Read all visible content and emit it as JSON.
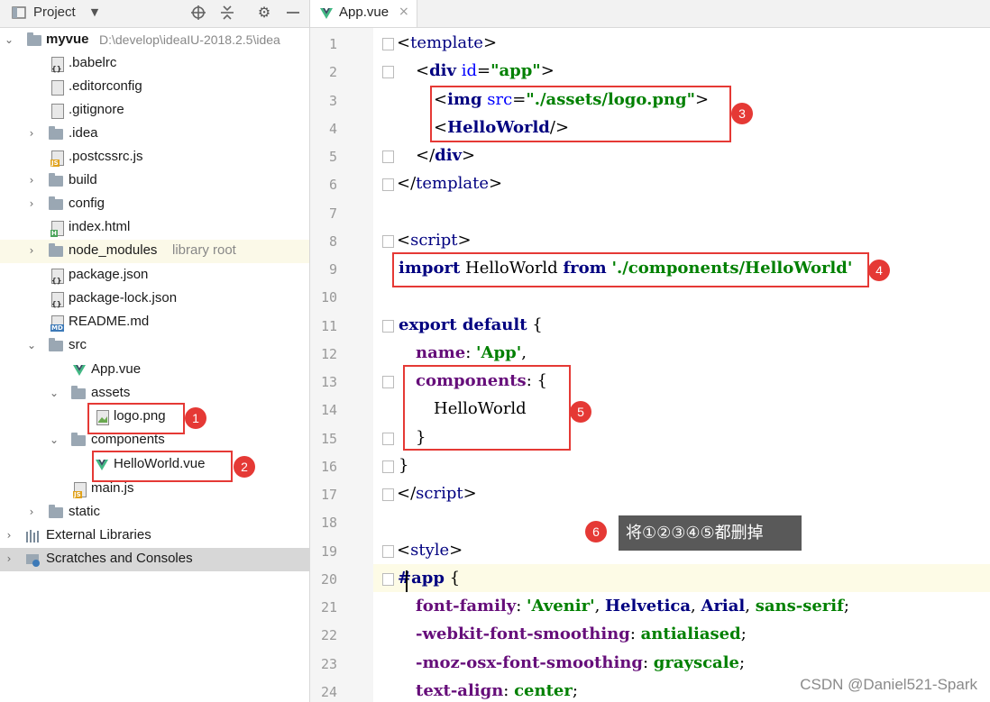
{
  "project_panel": {
    "title": "Project",
    "tree": [
      {
        "name": "myvue",
        "path": "D:\\develop\\ideaIU-2018.2.5\\idea",
        "icon": "folder-module-icon"
      },
      {
        "name": ".babelrc",
        "icon": "json-file-icon"
      },
      {
        "name": ".editorconfig",
        "icon": "text-file-icon"
      },
      {
        "name": ".gitignore",
        "icon": "text-file-icon"
      },
      {
        "name": ".idea",
        "icon": "folder-icon"
      },
      {
        "name": ".postcssrc.js",
        "icon": "js-file-icon"
      },
      {
        "name": "build",
        "icon": "folder-icon"
      },
      {
        "name": "config",
        "icon": "folder-icon"
      },
      {
        "name": "index.html",
        "icon": "html-file-icon"
      },
      {
        "name": "node_modules",
        "path": "library root",
        "icon": "folder-icon"
      },
      {
        "name": "package.json",
        "icon": "json-file-icon"
      },
      {
        "name": "package-lock.json",
        "icon": "json-file-icon"
      },
      {
        "name": "README.md",
        "icon": "markdown-file-icon"
      },
      {
        "name": "src",
        "icon": "folder-icon"
      },
      {
        "name": "App.vue",
        "icon": "vue-file-icon"
      },
      {
        "name": "assets",
        "icon": "folder-icon"
      },
      {
        "name": "logo.png",
        "icon": "image-file-icon"
      },
      {
        "name": "components",
        "icon": "folder-icon"
      },
      {
        "name": "HelloWorld.vue",
        "icon": "vue-file-icon"
      },
      {
        "name": "main.js",
        "icon": "js-file-icon"
      },
      {
        "name": "static",
        "icon": "folder-icon"
      },
      {
        "name": "External Libraries",
        "icon": "library-icon"
      },
      {
        "name": "Scratches and Consoles",
        "icon": "scratches-icon"
      }
    ]
  },
  "editor": {
    "tab_label": "App.vue",
    "line_numbers": [
      "1",
      "2",
      "3",
      "4",
      "5",
      "6",
      "7",
      "8",
      "9",
      "10",
      "11",
      "12",
      "13",
      "14",
      "15",
      "16",
      "17",
      "18",
      "19",
      "20",
      "21",
      "22",
      "23",
      "24"
    ],
    "code": {
      "l1": {
        "lt": "<",
        "tag": "template",
        "gt": ">"
      },
      "l2": {
        "lt": "<",
        "tag": "div",
        "attr": " id",
        "eq": "=",
        "val": "\"app\"",
        "gt": ">"
      },
      "l3": {
        "lt": "<",
        "tag": "img",
        "attr": " src",
        "eq": "=",
        "val": "\"./assets/logo.png\"",
        "gt": ">"
      },
      "l4": {
        "lt": "<",
        "tag": "HelloWorld",
        "end": "/>"
      },
      "l5": {
        "lt": "</",
        "tag": "div",
        "gt": ">"
      },
      "l6": {
        "lt": "</",
        "tag": "template",
        "gt": ">"
      },
      "l8": {
        "lt": "<",
        "tag": "script",
        "gt": ">"
      },
      "l9": {
        "kw1": "import",
        "id": " HelloWorld ",
        "kw2": "from",
        "sp": " ",
        "str": "'./components/HelloWorld'"
      },
      "l11": {
        "kw": "export default",
        "rest": " {"
      },
      "l12": {
        "prop": "name",
        "colon": ": ",
        "str": "'App'",
        "comma": ","
      },
      "l13": {
        "prop": "components",
        "rest": ": {"
      },
      "l14": {
        "id": "HelloWorld"
      },
      "l15": {
        "brace": "}"
      },
      "l16": {
        "brace": "}"
      },
      "l17": {
        "lt": "</",
        "tag": "script",
        "gt": ">"
      },
      "l19": {
        "lt": "<",
        "tag": "style",
        "gt": ">"
      },
      "l20": {
        "sel": "#app",
        "rest": " {"
      },
      "l21": {
        "prop": "font-family",
        "colon": ": ",
        "v1": "'Avenir'",
        "c1": ", ",
        "v2": "Helvetica",
        "c2": ", ",
        "v3": "Arial",
        "c3": ", ",
        "v4": "sans-serif",
        "end": ";"
      },
      "l22": {
        "prop": "-webkit-font-smoothing",
        "colon": ": ",
        "val": "antialiased",
        "end": ";"
      },
      "l23": {
        "prop": "-moz-osx-font-smoothing",
        "colon": ": ",
        "val": "grayscale",
        "end": ";"
      },
      "l24": {
        "prop": "text-align",
        "colon": ": ",
        "val": "center",
        "end": ";"
      }
    }
  },
  "annotations": {
    "markers": [
      "1",
      "2",
      "3",
      "4",
      "5",
      "6"
    ],
    "tooltip": "将①②③④⑤都删掉",
    "color": "#e53935"
  },
  "watermark": "CSDN @Daniel521-Spark"
}
